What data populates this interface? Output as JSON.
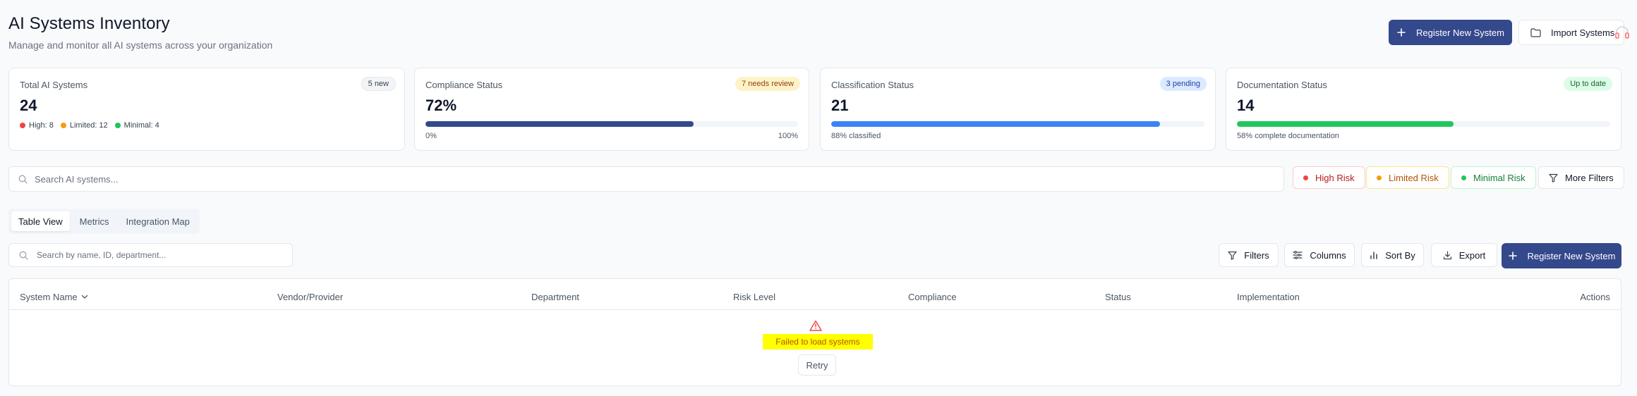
{
  "header": {
    "title": "AI Systems Inventory",
    "subtitle": "Manage and monitor all AI systems across your organization",
    "register_label": "Register New System",
    "import_label": "Import Systems"
  },
  "cards": {
    "total": {
      "label": "Total AI Systems",
      "value": "24",
      "badge": "5 new",
      "high": "High: 8",
      "limited": "Limited: 12",
      "minimal": "Minimal: 4"
    },
    "compliance": {
      "label": "Compliance Status",
      "value": "72%",
      "badge": "7 needs review",
      "progress": 0.72,
      "min_label": "0%",
      "max_label": "100%"
    },
    "classification": {
      "label": "Classification Status",
      "value": "21",
      "badge": "3 pending",
      "progress": 0.88,
      "caption": "88% classified"
    },
    "documentation": {
      "label": "Documentation Status",
      "value": "14",
      "badge": "Up to date",
      "progress": 0.58,
      "caption": "58% complete documentation"
    }
  },
  "search": {
    "placeholder": "Search AI systems...",
    "filters": {
      "high": "High Risk",
      "limited": "Limited Risk",
      "minimal": "Minimal Risk",
      "more": "More Filters"
    }
  },
  "tabs": [
    "Table View",
    "Metrics",
    "Integration Map"
  ],
  "table_toolbar": {
    "search_placeholder": "Search by name, ID, department...",
    "filters": "Filters",
    "columns": "Columns",
    "sort_by": "Sort By",
    "export": "Export",
    "register": "Register New System"
  },
  "table": {
    "columns": [
      "System Name",
      "Vendor/Provider",
      "Department",
      "Risk Level",
      "Compliance",
      "Status",
      "Implementation",
      "Actions"
    ],
    "error_message": "Failed to load systems",
    "retry_label": "Retry"
  },
  "colors": {
    "primary": "#34488c",
    "high": "#ef4444",
    "limited": "#f59e0b",
    "minimal": "#22c55e",
    "classification_bar": "#3b82f6",
    "documentation_bar": "#22c55e",
    "highlight": "#ffff00"
  },
  "icons": {
    "plus": "plus-icon",
    "folder": "folder-icon",
    "search": "search-icon",
    "filter": "filter-icon",
    "columns": "columns-icon",
    "sort": "bar-chart-icon",
    "export": "download-icon",
    "warning": "warning-triangle-icon",
    "chevron": "chevron-down-icon",
    "headset": "headset-icon"
  }
}
